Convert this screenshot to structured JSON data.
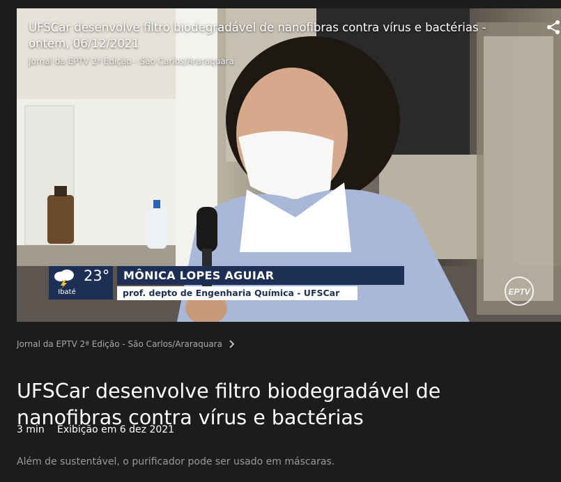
{
  "video": {
    "overlay_title": "UFSCar desenvolve filtro biodegradável de nanofibras contra vírus e bactérias - ontem, 06/12/2021",
    "overlay_subtitle": "Jornal da EPTV 2ª Edição - São Carlos/Araraquara",
    "share_icon": "share-icon",
    "lower_third": {
      "temperature": "23°",
      "city": "Ibaté",
      "weather_icon": "storm-cloud-icon",
      "name": "MÔNICA LOPES AGUIAR",
      "role": "prof. depto de Engenharia Química - UFSCar"
    },
    "channel_logo": "EPTV"
  },
  "breadcrumb": {
    "label": "Jornal da EPTV 2ª Edição - São Carlos/Araraquara",
    "icon": "chevron-right-icon"
  },
  "title": "UFSCar desenvolve filtro biodegradável de nanofibras contra vírus e bactérias",
  "meta": {
    "duration": "3 min",
    "aired": "Exibição em 6 dez 2021"
  },
  "description": "Além de sustentável, o purificador pode ser usado em máscaras.",
  "colors": {
    "page_background": "#1c1c1c",
    "lower_third_blue": "#1d2f55",
    "muted_text": "#9a9a9a"
  }
}
